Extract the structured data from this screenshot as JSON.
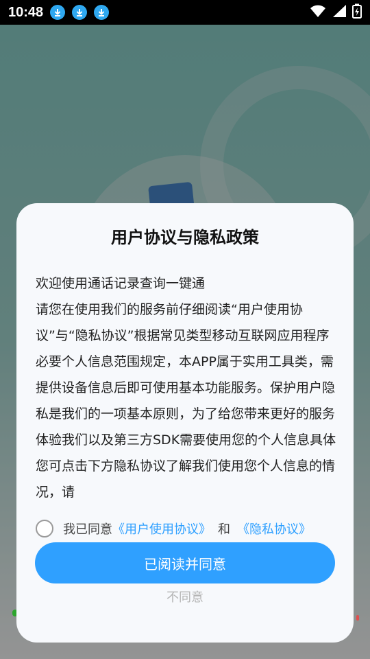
{
  "status_bar": {
    "time": "10:48",
    "notifications": [
      "download-icon",
      "download-icon",
      "download-icon"
    ],
    "icons": [
      "wifi-icon",
      "signal-icon",
      "battery-charging-icon"
    ]
  },
  "dialog": {
    "title": "用户协议与隐私政策",
    "body": [
      "欢迎使用通话记录查询一键通",
      "请您在使用我们的服务前仔细阅读“用户使用协议”与“隐私协议”根据常见类型移动互联网应用程序必要个人信息范围规定，本APP属于实用工具类，需提供设备信息后即可使用基本功能服务。保护用户隐私是我们的一项基本原则，为了给您带来更好的服务体验我们以及第三方SDK需要使用您的个人信息具体您可点击下方隐私协议了解我们使用您个人信息的情况，请"
    ],
    "agree_prefix": "我已同意",
    "user_agreement_link": "《用户使用协议》",
    "and_text": "和",
    "privacy_link": "《隐私协议》",
    "agree_button": "已阅读并同意",
    "disagree_button": "不同意"
  },
  "colors": {
    "accent": "#2fa0ff",
    "dialog_bg": "#f7f9fc",
    "disagree_text": "#b5b5b5"
  }
}
